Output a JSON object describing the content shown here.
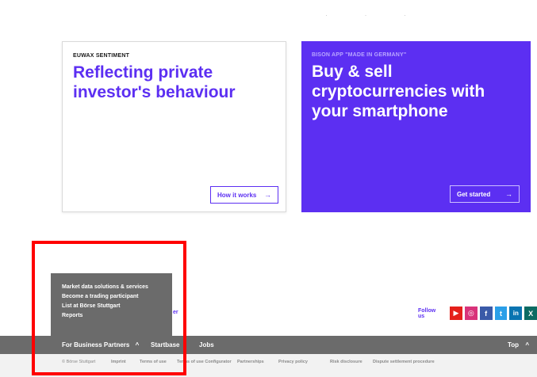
{
  "cards": {
    "left": {
      "eyebrow": "EUWAX SENTIMENT",
      "headline": "Reflecting private investor's behaviour",
      "cta": "How it works",
      "arrow": "→"
    },
    "right": {
      "eyebrow": "BISON APP \"MADE IN GERMANY\"",
      "headline": "Buy & sell cryptocurrencies with your smartphone",
      "cta": "Get started",
      "arrow": "→"
    }
  },
  "business_menu": {
    "items": [
      "Market data solutions & services",
      "Become a trading participant",
      "List at Börse Stuttgart",
      "Reports"
    ]
  },
  "partial_text": "er",
  "social": {
    "label": "Follow us",
    "icons": [
      "youtube-icon",
      "instagram-icon",
      "facebook-icon",
      "twitter-icon",
      "linkedin-icon",
      "xing-icon"
    ],
    "glyphs": {
      "youtube": "▶",
      "instagram": "◎",
      "facebook": "f",
      "twitter": "t",
      "linkedin": "in",
      "xing": "X"
    }
  },
  "footer": {
    "business_partners": "For Business Partners",
    "business_chevron": "^",
    "startbase": "Startbase",
    "jobs": "Jobs",
    "top": "Top",
    "top_chevron": "^",
    "links": [
      "© Börse Stuttgart",
      "Imprint",
      "Terms of use",
      "Terms of use Configurator",
      "Partnerships",
      "Privacy policy",
      "Risk disclosure",
      "Dispute settlement procedure"
    ]
  },
  "colors": {
    "brand_purple": "#5c2ff2",
    "footer_gray": "#6b6b6b",
    "highlight_red": "#ff0000"
  }
}
